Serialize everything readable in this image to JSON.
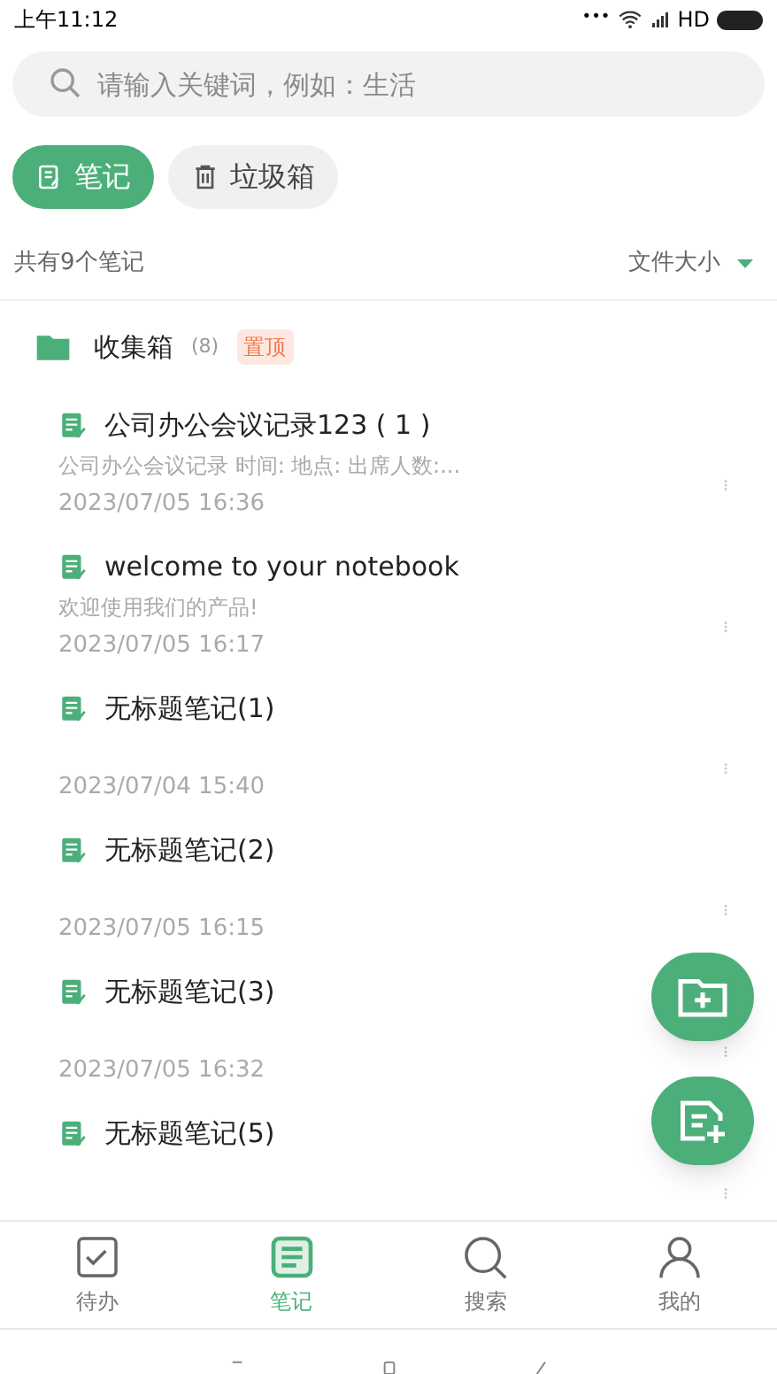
{
  "status_bar": {
    "time": "上午11:12",
    "dots": "•••",
    "network": "HD"
  },
  "search": {
    "placeholder": "请输入关键词，例如：生活"
  },
  "tabs": [
    {
      "label": "笔记",
      "kind": "notes",
      "selected": true
    },
    {
      "label": "垃圾箱",
      "kind": "trash",
      "selected": false
    }
  ],
  "summary": {
    "count": "共有9个笔记",
    "sort": "文件大小"
  },
  "folder": {
    "name": "收集箱",
    "count": "(8)",
    "badge": "置顶"
  },
  "notes": [
    {
      "title": "公司办公会议记录123 ( 1 )",
      "preview": "公司办公会议记录  时间: 地点: 出席人数:...",
      "date": "2023/07/05 16:36"
    },
    {
      "title": "welcome to your notebook",
      "preview": "欢迎使用我们的产品!",
      "date": "2023/07/05 16:17"
    },
    {
      "title": "无标题笔记(1)",
      "date": "2023/07/04 15:40"
    },
    {
      "title": "无标题笔记(2)",
      "date": "2023/07/05 16:15"
    },
    {
      "title": "无标题笔记(3)",
      "date": "2023/07/05 16:32"
    },
    {
      "title": "无标题笔记(5)"
    }
  ],
  "nav": [
    {
      "label": "待办",
      "kind": "todo",
      "selected": false
    },
    {
      "label": "笔记",
      "kind": "notes",
      "selected": true
    },
    {
      "label": "搜索",
      "kind": "search",
      "selected": false
    },
    {
      "label": "我的",
      "kind": "profile",
      "selected": false
    }
  ]
}
